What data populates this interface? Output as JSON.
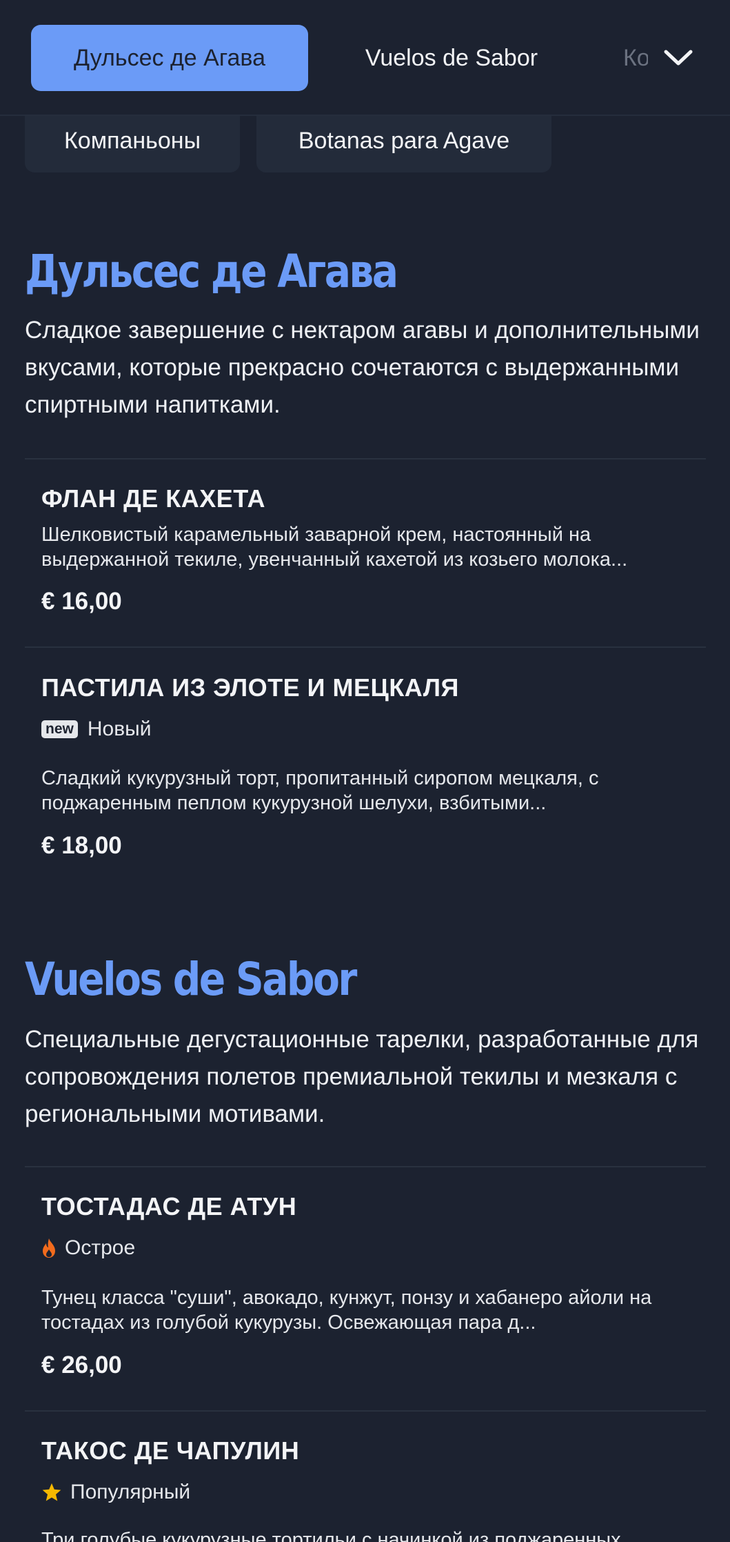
{
  "nav": {
    "tabs": [
      {
        "label": "Дульсес де Агава",
        "active": true
      },
      {
        "label": "Vuelos de Sabor",
        "active": false
      },
      {
        "label": "Компаньоны",
        "active": false
      }
    ],
    "more_icon": "chevron-down-icon",
    "sub_tabs": [
      {
        "label": "Компаньоны"
      },
      {
        "label": "Botanas para Agave"
      }
    ]
  },
  "sections": [
    {
      "title": "Дульсес де Агава",
      "description": "Сладкое завершение с нектаром агавы и дополнительными вкусами, которые прекрасно сочетаются с выдержанными спиртными напитками.",
      "items": [
        {
          "name": "ФЛАН ДЕ КАХЕТА",
          "description": "Шелковистый карамельный заварной крем, настоянный на выдержанной текиле, увенчанный кахетой из козьего молока...",
          "price": "€ 16,00"
        },
        {
          "name": "ПАСТИЛА ИЗ ЭЛОТЕ И МЕЦКАЛЯ",
          "badge_tag": "new",
          "badge_label": "Новый",
          "description": "Сладкий кукурузный торт, пропитанный сиропом мецкаля, с поджаренным пеплом кукурузной шелухи, взбитыми...",
          "price": "€ 18,00"
        }
      ]
    },
    {
      "title": "Vuelos de Sabor",
      "description": "Специальные дегустационные тарелки, разработанные для сопровождения полетов премиальной текилы и мезкаля с региональными мотивами.",
      "items": [
        {
          "name": "ТОСТАДАС ДЕ АТУН",
          "badge_icon": "flame-icon",
          "badge_label": "Острое",
          "description": "Тунец класса \"суши\", авокадо, кунжут, понзу и хабанеро айоли на тостадах из голубой кукурузы. Освежающая пара д...",
          "price": "€ 26,00"
        },
        {
          "name": "ТАКОС ДЕ ЧАПУЛИН",
          "badge_icon": "star-icon",
          "badge_label": "Популярный",
          "description": "Три голубые кукурузные тортильи с начинкой из поджаренных"
        }
      ]
    }
  ],
  "colors": {
    "background": "#1c2230",
    "accent": "#6b9bf7",
    "card": "#232b3a",
    "flame": "#f26b1d",
    "star": "#f5b800"
  }
}
